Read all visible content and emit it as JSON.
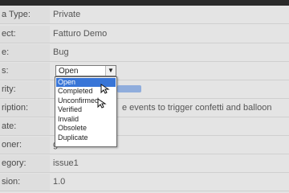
{
  "fields": [
    {
      "label": "a Type:",
      "value": "Private"
    },
    {
      "label": "ect:",
      "value": "Fatturo Demo"
    },
    {
      "label": "e:",
      "value": "Bug"
    },
    {
      "label": "s:",
      "value": ""
    },
    {
      "label": "rity:",
      "value": ""
    },
    {
      "label": "ription:",
      "value": "",
      "desc": "e events to trigger confetti and balloon"
    },
    {
      "label": "ate:",
      "value": ""
    },
    {
      "label": "oner:",
      "value": "guest2"
    },
    {
      "label": "egory:",
      "value": "issue1"
    },
    {
      "label": "sion:",
      "value": "1.0"
    },
    {
      "label": "",
      "value": ""
    }
  ],
  "status_select": {
    "value": "Open",
    "options": [
      "Open",
      "Completed",
      "Unconfirmed",
      "Verified",
      "Invalid",
      "Obsolete",
      "Duplicate"
    ],
    "selected_index": 0
  },
  "icons": {
    "dropdown_arrow": "chevron-down-icon",
    "cursor": "pointer-cursor-icon"
  },
  "colors": {
    "selection": "#3875d7"
  }
}
